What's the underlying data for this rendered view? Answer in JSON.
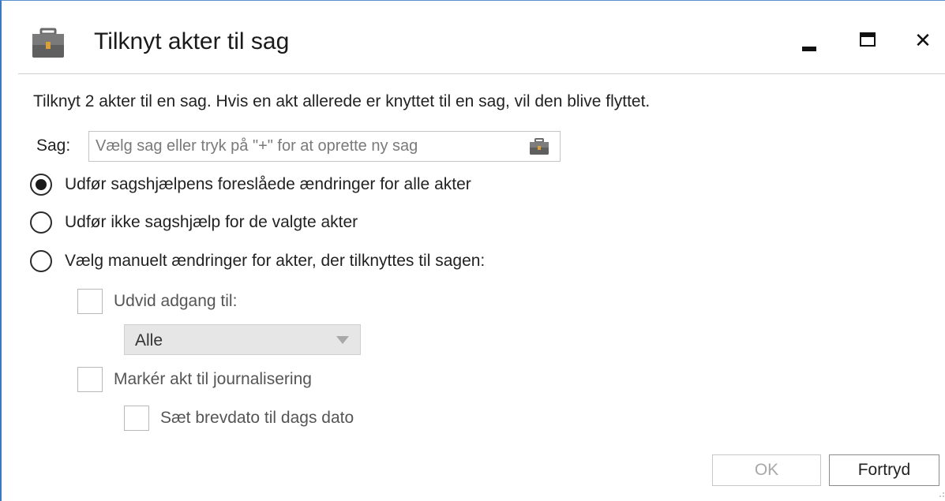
{
  "window": {
    "title": "Tilknyt akter til sag",
    "icon": "briefcase-icon",
    "controls": [
      "minimize-icon",
      "maximize-icon",
      "close-icon"
    ],
    "close_glyph": "✕"
  },
  "intro_text": "Tilknyt 2 akter til en sag. Hvis en akt allerede er knyttet til en sag, vil den blive flyttet.",
  "sag": {
    "label": "Sag:",
    "value": "",
    "placeholder": "Vælg sag eller tryk på \"+\" for at oprette ny sag",
    "icon": "briefcase-icon"
  },
  "options": [
    {
      "label": "Udfør sagshjælpens foreslåede ændringer for alle akter",
      "selected": true
    },
    {
      "label": "Udfør ikke sagshjælp for de valgte akter",
      "selected": false
    },
    {
      "label": "Vælg manuelt ændringer for akter, der tilknyttes til sagen:",
      "selected": false
    }
  ],
  "manual": {
    "udvid_label": "Udvid adgang til:",
    "udvid_checked": false,
    "access_select": {
      "value": "Alle",
      "disabled": true
    },
    "journal_label": "Markér akt til journalisering",
    "journal_checked": false,
    "brevdato_label": "Sæt brevdato til dags dato",
    "brevdato_checked": false
  },
  "buttons": {
    "ok": "OK",
    "ok_disabled": true,
    "cancel": "Fortryd"
  },
  "colors": {
    "accent_border": "#3a78c4",
    "disabled_text": "#a8a8a8"
  }
}
